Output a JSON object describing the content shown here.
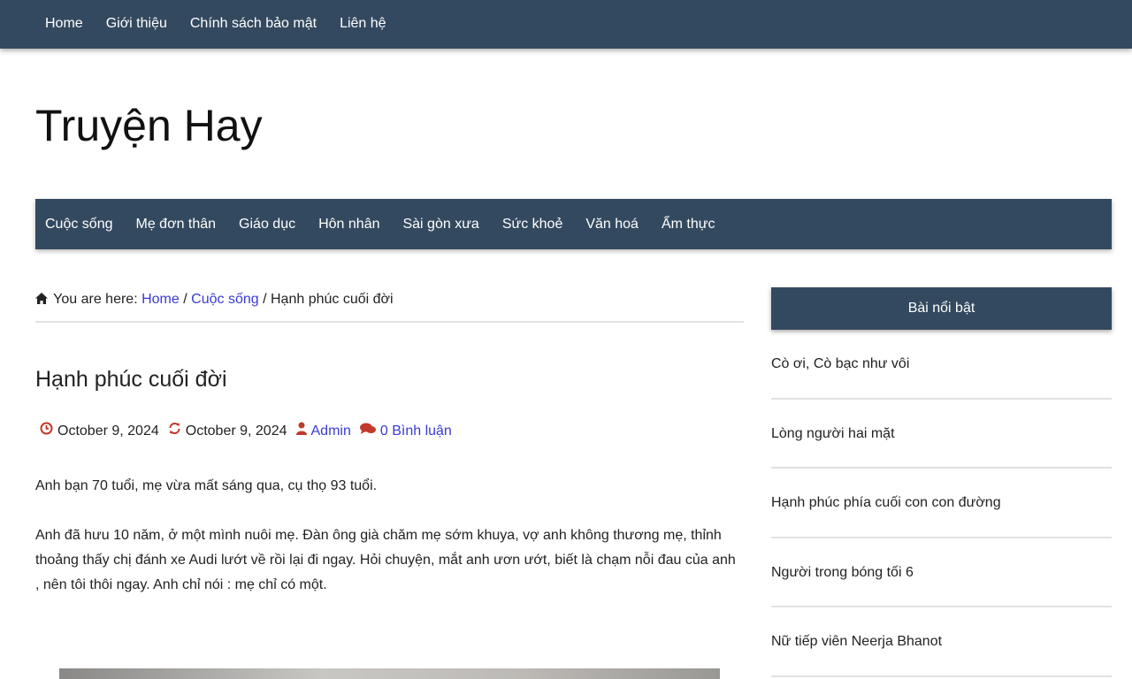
{
  "topbar": {
    "items": [
      "Home",
      "Giới thiệu",
      "Chính sách bảo mật",
      "Liên hệ"
    ]
  },
  "site": {
    "title": "Truyện Hay"
  },
  "mainnav": {
    "items": [
      "Cuộc sống",
      "Mẹ đơn thân",
      "Giáo dục",
      "Hôn nhân",
      "Sài gòn xưa",
      "Sức khoẻ",
      "Văn hoá",
      "Ẩm thực"
    ]
  },
  "breadcrumb": {
    "prefix": "You are here:",
    "home": "Home",
    "sep": "/",
    "category": "Cuộc sống",
    "current": "Hạnh phúc cuối đời"
  },
  "post": {
    "title": "Hạnh phúc cuối đời",
    "published": "October 9, 2024",
    "updated": "October 9, 2024",
    "author": "Admin",
    "comments": "0 Bình luận",
    "paragraphs": [
      "Anh bạn 70 tuổi, mẹ vừa mất sáng qua, cụ thọ 93 tuổi.",
      "Anh đã hưu 10 năm, ở một mình nuôi mẹ. Đàn ông già chăm mẹ sớm khuya, vợ anh không thương mẹ, thỉnh thoảng thấy chị đánh xe Audi lướt về rồi lại đi ngay. Hỏi chuyện, mắt anh ươn ướt, biết là chạm nỗi đau của anh , nên tôi thôi ngay. Anh chỉ nói : mẹ chỉ có một."
    ]
  },
  "sidebar": {
    "heading": "Bài nổi bật",
    "items": [
      "Cò ơi, Cò bạc như vôi",
      "Lòng người hai mặt",
      "Hạnh phúc phía cuối con con đường",
      "Người trong bóng tối 6",
      "Nữ tiếp viên Neerja Bhanot"
    ]
  },
  "colors": {
    "nav_bg": "#33495f",
    "link": "#3a3ad6",
    "meta_icon": "#c0392b"
  },
  "icons": {
    "breadcrumb": "home-icon",
    "published": "clock-icon",
    "updated": "refresh-icon",
    "author": "user-icon",
    "comments": "comments-icon"
  }
}
